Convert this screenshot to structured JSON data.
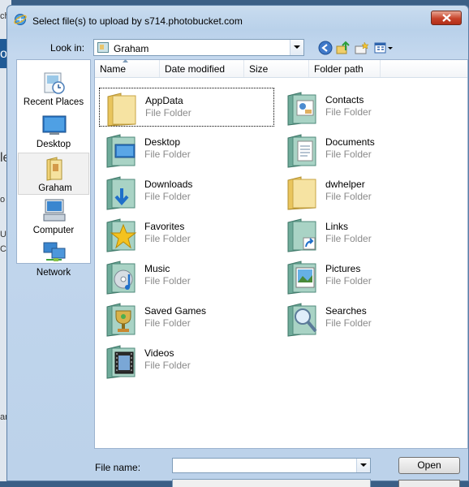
{
  "background_window": {
    "fragments": [
      "ch",
      "o",
      "le",
      "o",
      "Us",
      "Cr",
      "ar"
    ]
  },
  "dialog": {
    "title": "Select file(s) to upload by s714.photobucket.com",
    "look_in_label": "Look in:",
    "look_in_value": "Graham",
    "toolbar_icons": [
      "back-icon",
      "up-folder-icon",
      "new-folder-icon",
      "views-menu-icon"
    ]
  },
  "places_bar": {
    "items": [
      {
        "label": "Recent Places",
        "icon": "recent-places-icon"
      },
      {
        "label": "Desktop",
        "icon": "desktop-icon"
      },
      {
        "label": "Graham",
        "icon": "user-folder-icon",
        "selected": true
      },
      {
        "label": "Computer",
        "icon": "computer-icon"
      },
      {
        "label": "Network",
        "icon": "network-icon"
      }
    ]
  },
  "columns": [
    "Name",
    "Date modified",
    "Size",
    "Folder path"
  ],
  "files": [
    {
      "name": "AppData",
      "type": "File Folder",
      "icon": "plain-folder-icon",
      "focused": true
    },
    {
      "name": "Contacts",
      "type": "File Folder",
      "icon": "contacts-folder-icon"
    },
    {
      "name": "Desktop",
      "type": "File Folder",
      "icon": "desktop-folder-icon"
    },
    {
      "name": "Documents",
      "type": "File Folder",
      "icon": "documents-folder-icon"
    },
    {
      "name": "Downloads",
      "type": "File Folder",
      "icon": "downloads-folder-icon"
    },
    {
      "name": "dwhelper",
      "type": "File Folder",
      "icon": "plain-folder-icon"
    },
    {
      "name": "Favorites",
      "type": "File Folder",
      "icon": "favorites-folder-icon"
    },
    {
      "name": "Links",
      "type": "File Folder",
      "icon": "links-folder-icon"
    },
    {
      "name": "Music",
      "type": "File Folder",
      "icon": "music-folder-icon"
    },
    {
      "name": "Pictures",
      "type": "File Folder",
      "icon": "pictures-folder-icon"
    },
    {
      "name": "Saved Games",
      "type": "File Folder",
      "icon": "saved-games-folder-icon"
    },
    {
      "name": "Searches",
      "type": "File Folder",
      "icon": "searches-folder-icon"
    },
    {
      "name": "Videos",
      "type": "File Folder",
      "icon": "videos-folder-icon"
    }
  ],
  "file_name": {
    "label": "File name:",
    "value": ""
  },
  "buttons": {
    "open": "Open"
  },
  "colors": {
    "dialog_chrome": "#bcd2ea",
    "close_button": "#c7432a",
    "folder_teal": "#7fb8a8",
    "folder_yellow": "#f3d97a",
    "secondary_text": "#8a8a8a"
  }
}
